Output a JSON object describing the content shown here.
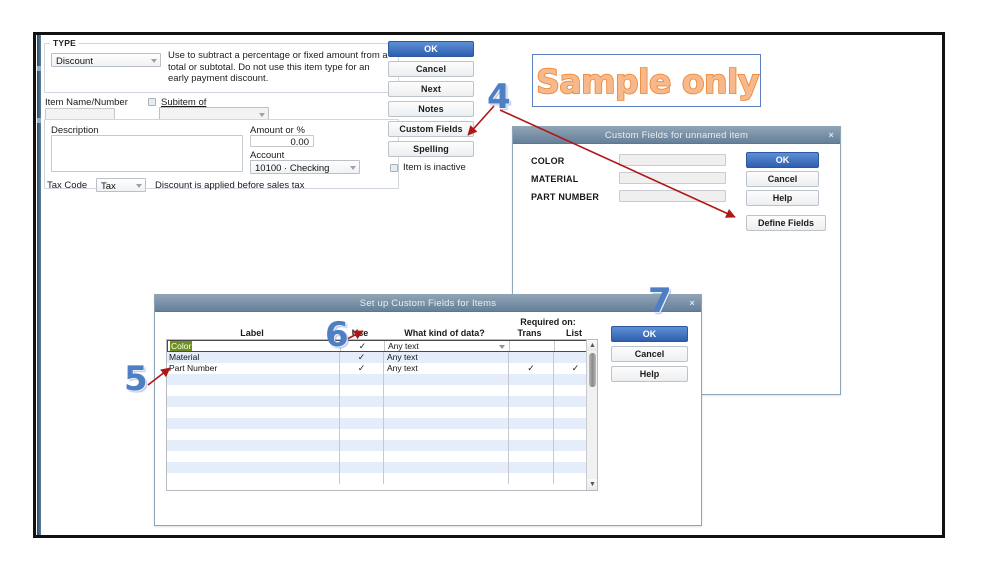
{
  "item_form": {
    "type_legend": "TYPE",
    "type_value": "Discount",
    "type_description": "Use to subtract a percentage or fixed amount from a total or subtotal. Do not use this item type for an early payment discount.",
    "item_name_label": "Item Name/Number",
    "item_name_value": "",
    "subitem_label": "Subitem of",
    "subitem_value": "",
    "description_label": "Description",
    "description_value": "",
    "amount_label": "Amount or %",
    "amount_value": "0.00",
    "account_label": "Account",
    "account_value": "10100 · Checking",
    "tax_code_label": "Tax Code",
    "tax_code_value": "Tax",
    "tax_note": "Discount is applied before sales tax",
    "item_inactive_label": "Item is inactive",
    "buttons": [
      {
        "label": "OK",
        "primary": true
      },
      {
        "label": "Cancel",
        "primary": false
      },
      {
        "label": "Next",
        "primary": false
      },
      {
        "label": "Notes",
        "primary": false
      },
      {
        "label": "Custom Fields",
        "primary": false
      },
      {
        "label": "Spelling",
        "primary": false
      }
    ]
  },
  "watermark": {
    "text": "Sample only",
    "fill_color": "#f7b98b",
    "outline_color": "#ef7f28",
    "border_color": "#5b7fc0"
  },
  "custom_fields_dialog": {
    "title": "Custom Fields for unnamed item",
    "close_icon": "×",
    "fields": [
      {
        "label": "COLOR",
        "value": ""
      },
      {
        "label": "MATERIAL",
        "value": ""
      },
      {
        "label": "PART NUMBER",
        "value": ""
      }
    ],
    "buttons": [
      {
        "label": "OK",
        "primary": true
      },
      {
        "label": "Cancel",
        "primary": false
      },
      {
        "label": "Help",
        "primary": false
      }
    ],
    "define_fields_label": "Define Fields"
  },
  "setup_dialog": {
    "title": "Set up Custom Fields for Items",
    "close_icon": "×",
    "required_on_label": "Required on:",
    "columns": [
      "Label",
      "Use",
      "What kind of data?",
      "Trans",
      "List"
    ],
    "rows": [
      {
        "label": "Color",
        "selected": true,
        "use": true,
        "kind": "Any text",
        "trans": false,
        "list": false
      },
      {
        "label": "Material",
        "selected": false,
        "use": true,
        "kind": "Any text",
        "trans": false,
        "list": false
      },
      {
        "label": "Part Number",
        "selected": false,
        "use": true,
        "kind": "Any text",
        "trans": true,
        "list": true
      },
      {
        "label": "",
        "selected": false,
        "use": false,
        "kind": "",
        "trans": false,
        "list": false
      },
      {
        "label": "",
        "selected": false,
        "use": false,
        "kind": "",
        "trans": false,
        "list": false
      },
      {
        "label": "",
        "selected": false,
        "use": false,
        "kind": "",
        "trans": false,
        "list": false
      },
      {
        "label": "",
        "selected": false,
        "use": false,
        "kind": "",
        "trans": false,
        "list": false
      },
      {
        "label": "",
        "selected": false,
        "use": false,
        "kind": "",
        "trans": false,
        "list": false
      },
      {
        "label": "",
        "selected": false,
        "use": false,
        "kind": "",
        "trans": false,
        "list": false
      },
      {
        "label": "",
        "selected": false,
        "use": false,
        "kind": "",
        "trans": false,
        "list": false
      },
      {
        "label": "",
        "selected": false,
        "use": false,
        "kind": "",
        "trans": false,
        "list": false
      },
      {
        "label": "",
        "selected": false,
        "use": false,
        "kind": "",
        "trans": false,
        "list": false
      },
      {
        "label": "",
        "selected": false,
        "use": false,
        "kind": "",
        "trans": false,
        "list": false
      }
    ],
    "tick_glyph": "✓",
    "buttons": [
      {
        "label": "OK",
        "primary": true
      },
      {
        "label": "Cancel",
        "primary": false
      },
      {
        "label": "Help",
        "primary": false
      }
    ]
  },
  "annotations": {
    "color": "#4e7ec4",
    "arrow_color": "#b01616",
    "numbers": [
      {
        "text": "4"
      },
      {
        "text": "5"
      },
      {
        "text": "6"
      },
      {
        "text": "7"
      }
    ]
  }
}
